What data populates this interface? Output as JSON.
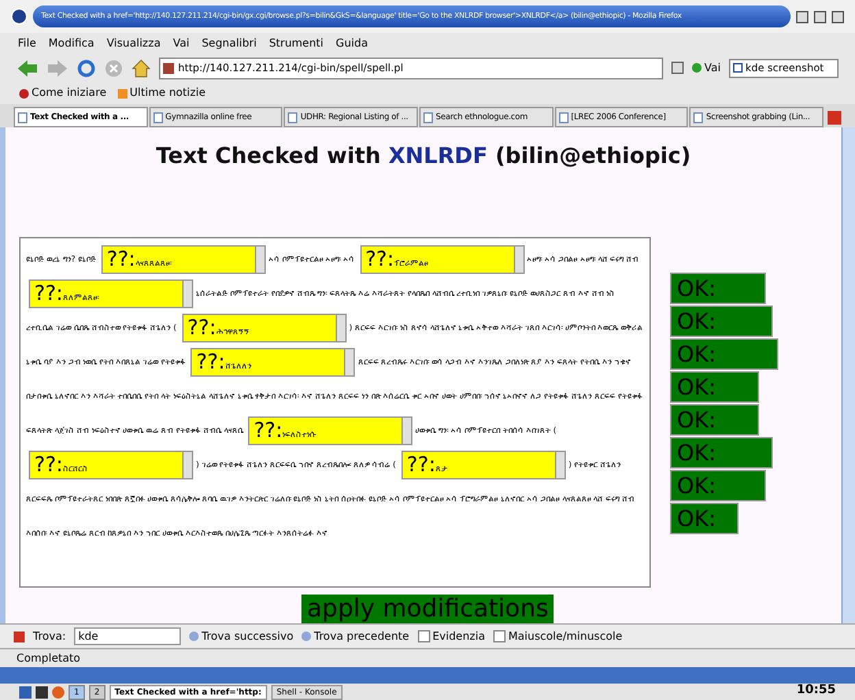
{
  "window": {
    "title": "Text Checked with a href='http://140.127.211.214/cgi-bin/gx.cgi/browse.pl?s=bilin&GkS=&language' title='Go to the XNLRDF browser'>XNLRDF</a> (bilin@ethiopic) - Mozilla Firefox"
  },
  "menu": [
    "File",
    "Modifica",
    "Visualizza",
    "Vai",
    "Segnalibri",
    "Strumenti",
    "Guida"
  ],
  "toolbar": {
    "url": "http://140.127.211.214/cgi-bin/spell/spell.pl",
    "go_label": "Vai",
    "search_value": "kde screenshot"
  },
  "bookmarks": [
    "Come iniziare",
    "Ultime notizie"
  ],
  "tabs": [
    {
      "label": "Text Checked with a ...",
      "selected": true
    },
    {
      "label": "Gymnazilla online free",
      "selected": false
    },
    {
      "label": "UDHR: Regional Listing of ...",
      "selected": false
    },
    {
      "label": "Search ethnologue.com",
      "selected": false
    },
    {
      "label": "[LREC 2006 Conference]",
      "selected": false
    },
    {
      "label": "Screenshot grabbing (Lin...",
      "selected": false
    }
  ],
  "page": {
    "heading_before": "Text Checked with",
    "heading_link": "XNLRDF",
    "heading_after": "(bilin@ethiopic)",
    "segments": [
      {
        "kind": "text",
        "text": "ዩኒቦድ ወረኒ ግን? ዩኒቦድ"
      },
      {
        "kind": "select",
        "value": "??:ላናጸጸልጸፀ፡"
      },
      {
        "kind": "text",
        "text": "ኣሳ ቦምፕዩተርልፀ ኣፀግ፡ ኣሳ"
      },
      {
        "kind": "select",
        "value": "??:ፕሮራምልፀ"
      },
      {
        "kind": "text",
        "text": "ኣፀግ፡ ኣሳ ጋበልፀ ኣፀግ፡ ላሸ ፍሩግ ሸብ"
      },
      {
        "kind": "select",
        "value": "??:ጸለምልጸፀ፡"
      },
      {
        "kind": "text",
        "text": "ኒሰራትልድ ቦምፕዩተራት የበደዎኖ ሸብጼ ግን፡ ፍጸላትጼ እሬ እሻራትጸት የላበጼበ ላሸብሴ ረተቢነበ ገዎጸኒበ፡ ዩኒቦድ ወሀጸስጋር ጸብ እኖ ሸብ ነስ ረተቢሴል ገሬወ ሴበጼ ሸብስተወ የትዩቱፋ ሸጌለን ("
      },
      {
        "kind": "select",
        "value": "??:ሕኅዋጸኝኝ"
      },
      {
        "kind": "text",
        "text": ") ጸርፍፍ እርገበ፡ ነስ ጸኖሳ ላሸጌለኖ ኒቱሴ ኣቅተወ እሻራት ገጸበ እርገሳ፡ ሀምቦንትበ እወርጼ ወቅሪል ኒቱሴ ባያ እን ጋብ ነወሴ የትበ እበጸኒል ገሬወ የትዩቱፋ"
      },
      {
        "kind": "select",
        "value": "??:ሸጌለለን"
      },
      {
        "kind": "text",
        "text": "ጸርፍፍ ጸረብጼሩ እርገበ፡ ወሳ ላጋብ እኖ እንገጼለ ጋበለነጽ ጸያ እን ፍጸላት የትበሴ እን ኀቁኖ በታበቱሴ ኒለኖበር እን እሻራት ተበሴበሴ የትበ ላት ነፍዕስትኒል ላሸጌለኖ ኒቱሴ ፃቅታበ እርገሳ፡ እኖ ሸጌለን ጸርፍፍ ነን በጽ እሰሬርሴ ቱር ኣበኖ ሀወት ሀምበበ፡ ኀሰኖ ኒኣበኖኖ ለጋ የትዩቱፋ ሸጌለን ጸርፍፍ የትዩቱፋ ፍጸላትጽ ላጀገስ ሸብ ነፍዕስተኖ ሀወቱሴ ዉሬ ጸብ የትዩቱፋ ሸብሴ ላናጸሴ"
      },
      {
        "kind": "select",
        "value": "??:ነፍለስተነሱ"
      },
      {
        "kind": "text",
        "text": "ሀወቱሴ ግን፡ ኣሳ ቦምፕዩተርበ ትበሰሳ እበገጸት ("
      },
      {
        "kind": "select",
        "value": "??:ስርሸርስ"
      },
      {
        "kind": "text",
        "text": ") ገሬወ የትዩቱፋ ሸጌለን ጸርፍፍሴ ኀበኖ ጸረብጼበሎ፡ ጸለዎ ሳብሬ ("
      },
      {
        "kind": "select",
        "value": "??:ጸታ"
      },
      {
        "kind": "text",
        "text": ") የትዩቱር ሸጌለን ጸርፍፍጼ ቦምፕዩተራትጸር ነበበጽ ጸኟበፉ ሀወቱሴ ጸሳሌቅሎ ጸባሴ ዉገዎ እንትርጵር ገሬለበ፡ ዩኒቦድ ነስ ኒትበ ሰዐትበፉ ዩኒቦድ ኣሳ ቦምፕዩተርልፀ ኣሳ ፕሮግራምልፀ ኒለኖበር ኣሳ ጋበልፀ ላናጸልጸፀ ላሸ ፍሩግ ሸብ እበሰበ፡ እኖ ዩኒቦጼሬ ጸርብ ከጸዎኒበ እን ኀበር ሀወቱሴ እርእስተወጼ በሀሌኚጼ ጣርፉት እንጸሰትሬፉ እኖ"
      }
    ],
    "ok_fields": [
      "OK:",
      "OK:",
      "OK:",
      "OK:",
      "OK:",
      "OK:",
      "OK:",
      "OK:"
    ],
    "apply_button": "apply modifications"
  },
  "find_bar": {
    "label": "Trova:",
    "value": "kde",
    "next": "Trova successivo",
    "previous": "Trova precedente",
    "highlight": {
      "label": "Evidenzia",
      "checked": false
    },
    "match_case": {
      "label": "Maiuscole/minuscole",
      "checked": false
    }
  },
  "status_bar": "Completato",
  "taskbar": {
    "desktops": [
      {
        "label": "1",
        "selected": true
      },
      {
        "label": "2",
        "selected": false
      }
    ],
    "tasks": [
      {
        "label": "Text Checked with a href='http:",
        "selected": true
      },
      {
        "label": "Shell - Konsole",
        "selected": false
      }
    ],
    "clock": "10:55"
  }
}
